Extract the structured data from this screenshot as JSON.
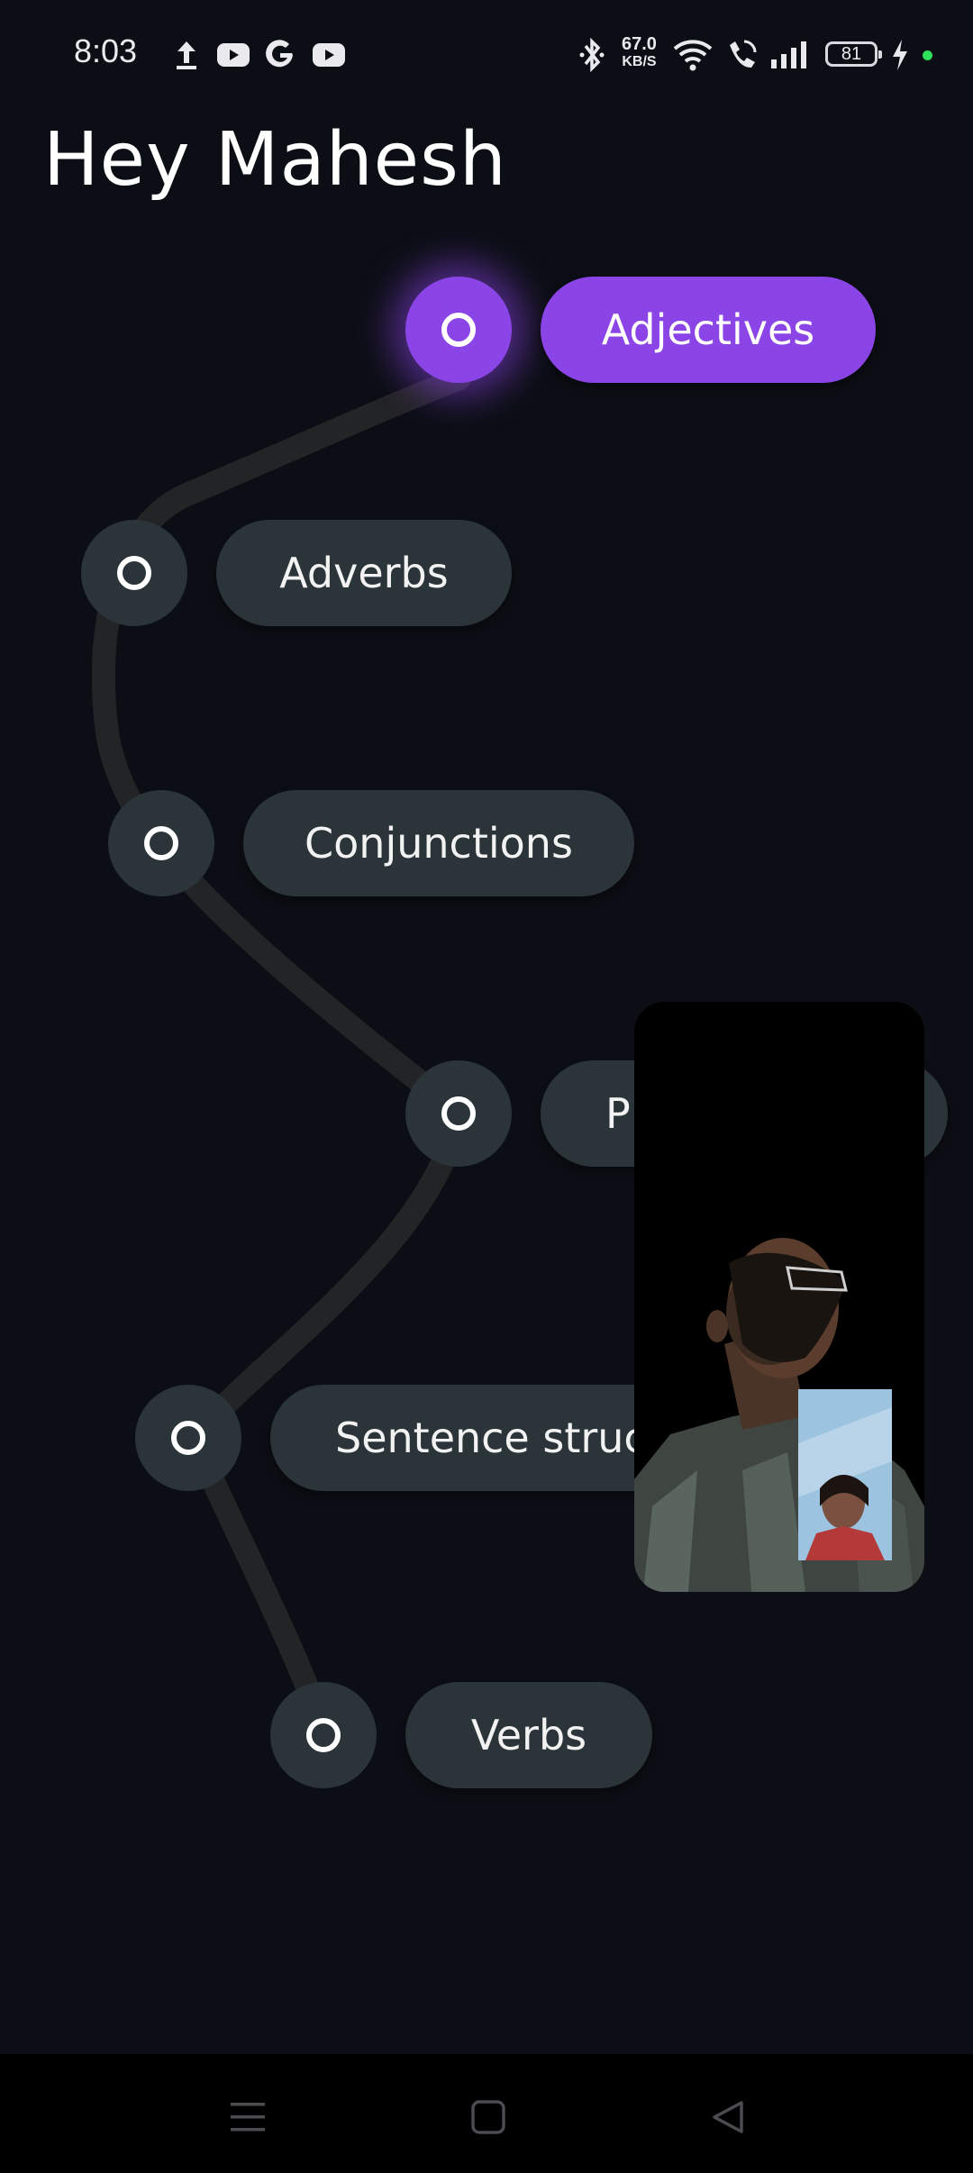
{
  "status_bar": {
    "time": "8:03",
    "speed_value": "67.0",
    "speed_unit": "KB/S",
    "battery": "81",
    "icons": [
      "upload-icon",
      "youtube-icon",
      "google-icon",
      "youtube-icon",
      "bluetooth-icon",
      "wifi-icon",
      "wifi-call-icon",
      "signal-icon",
      "battery-icon",
      "charging-icon"
    ]
  },
  "greeting": "Hey Mahesh",
  "topics": [
    {
      "label": "Adjectives",
      "active": true
    },
    {
      "label": "Adverbs",
      "active": false
    },
    {
      "label": "Conjunctions",
      "active": false
    },
    {
      "label": "P",
      "active": false
    },
    {
      "label": "Sentence struc",
      "active": false
    },
    {
      "label": "Verbs",
      "active": false
    }
  ],
  "colors": {
    "background": "#0c0e15",
    "accent": "#8b44e6",
    "node": "#2b3539",
    "path": "#232426"
  },
  "nav_bar": {
    "icons": [
      "menu-icon",
      "home-square-icon",
      "back-triangle-icon"
    ]
  }
}
